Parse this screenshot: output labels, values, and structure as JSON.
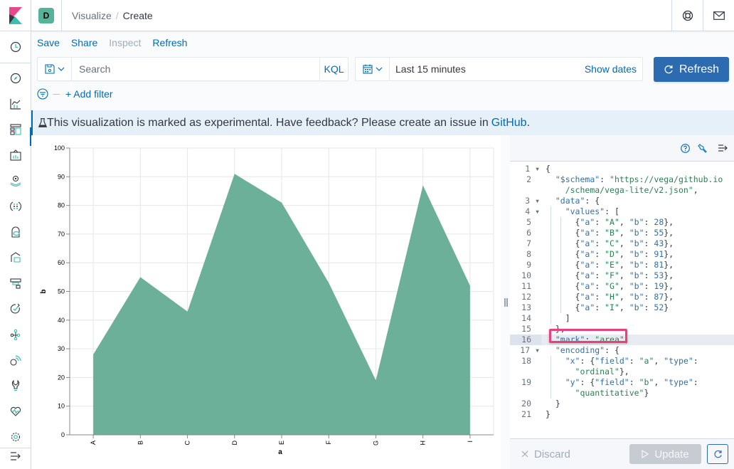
{
  "header": {
    "space_initial": "D",
    "breadcrumbs": [
      "Visualize",
      "Create"
    ],
    "separator": "/"
  },
  "topmenu": {
    "items": [
      {
        "label": "Save",
        "enabled": true
      },
      {
        "label": "Share",
        "enabled": true
      },
      {
        "label": "Inspect",
        "enabled": false
      },
      {
        "label": "Refresh",
        "enabled": true
      }
    ]
  },
  "querybar": {
    "search_placeholder": "Search",
    "search_value": "",
    "language": "KQL",
    "time_range": "Last 15 minutes",
    "show_dates": "Show dates",
    "refresh_label": "Refresh",
    "add_filter": "+ Add filter"
  },
  "banner": {
    "text": "This visualization is marked as experimental. Have feedback? Please create an issue in ",
    "link": "GitHub",
    "suffix": "."
  },
  "sidenav": {
    "items": [
      "recently-viewed",
      "discover",
      "visualize",
      "dashboard",
      "canvas",
      "maps",
      "machine-learning",
      "infrastructure",
      "logs",
      "apm",
      "uptime",
      "graph",
      "monitoring",
      "dev-tools",
      "stack-monitoring",
      "management",
      "collapse"
    ]
  },
  "colors": {
    "accent": "#006bb4",
    "area_fill": "#6db09a",
    "primary_button": "#2d6bb1",
    "highlight_box": "#e5427e"
  },
  "chart_data": {
    "type": "area",
    "categories": [
      "A",
      "B",
      "C",
      "D",
      "E",
      "F",
      "G",
      "H",
      "I"
    ],
    "values": [
      28,
      55,
      43,
      91,
      81,
      53,
      19,
      87,
      52
    ],
    "xlabel": "a",
    "ylabel": "b",
    "ylim": [
      0,
      100
    ],
    "yticks": [
      0,
      10,
      20,
      30,
      40,
      50,
      60,
      70,
      80,
      90,
      100
    ],
    "grid": true,
    "legend": "none"
  },
  "editor": {
    "lines": [
      {
        "n": "1",
        "fold": true,
        "html": "{"
      },
      {
        "n": "2",
        "fold": false,
        "html": "  <span class='k'>\"$schema\"</span>: <span class='s'>\"https://vega/github.io</span>"
      },
      {
        "n": "",
        "fold": false,
        "html": "    <span class='s'>/schema/vega-lite/v2.json\"</span>,"
      },
      {
        "n": "3",
        "fold": true,
        "html": "  <span class='k'>\"data\"</span>: {"
      },
      {
        "n": "4",
        "fold": true,
        "html": "    <span class='k'>\"values\"</span>: ["
      },
      {
        "n": "5",
        "fold": false,
        "html": "      {<span class='k'>\"a\"</span>: <span class='s'>\"A\"</span>, <span class='k'>\"b\"</span>: <span class='n'>28</span>},"
      },
      {
        "n": "6",
        "fold": false,
        "html": "      {<span class='k'>\"a\"</span>: <span class='s'>\"B\"</span>, <span class='k'>\"b\"</span>: <span class='n'>55</span>},"
      },
      {
        "n": "7",
        "fold": false,
        "html": "      {<span class='k'>\"a\"</span>: <span class='s'>\"C\"</span>, <span class='k'>\"b\"</span>: <span class='n'>43</span>},"
      },
      {
        "n": "8",
        "fold": false,
        "html": "      {<span class='k'>\"a\"</span>: <span class='s'>\"D\"</span>, <span class='k'>\"b\"</span>: <span class='n'>91</span>},"
      },
      {
        "n": "9",
        "fold": false,
        "html": "      {<span class='k'>\"a\"</span>: <span class='s'>\"E\"</span>, <span class='k'>\"b\"</span>: <span class='n'>81</span>},"
      },
      {
        "n": "10",
        "fold": false,
        "html": "      {<span class='k'>\"a\"</span>: <span class='s'>\"F\"</span>, <span class='k'>\"b\"</span>: <span class='n'>53</span>},"
      },
      {
        "n": "11",
        "fold": false,
        "html": "      {<span class='k'>\"a\"</span>: <span class='s'>\"G\"</span>, <span class='k'>\"b\"</span>: <span class='n'>19</span>},"
      },
      {
        "n": "12",
        "fold": false,
        "html": "      {<span class='k'>\"a\"</span>: <span class='s'>\"H\"</span>, <span class='k'>\"b\"</span>: <span class='n'>87</span>},"
      },
      {
        "n": "13",
        "fold": false,
        "html": "      {<span class='k'>\"a\"</span>: <span class='s'>\"I\"</span>, <span class='k'>\"b\"</span>: <span class='n'>52</span>}"
      },
      {
        "n": "14",
        "fold": false,
        "html": "    ]"
      },
      {
        "n": "15",
        "fold": false,
        "html": "  },"
      },
      {
        "n": "16",
        "fold": false,
        "active": true,
        "html": "  <span class='k'>\"mark\"</span>: <span class='s'>\"area\"</span>,"
      },
      {
        "n": "17",
        "fold": true,
        "html": "  <span class='k'>\"encoding\"</span>: {"
      },
      {
        "n": "18",
        "fold": false,
        "html": "    <span class='k'>\"x\"</span>: {<span class='k'>\"field\"</span>: <span class='s'>\"a\"</span>, <span class='k'>\"type\"</span>:"
      },
      {
        "n": "",
        "fold": false,
        "html": "      <span class='s'>\"ordinal\"</span>},"
      },
      {
        "n": "19",
        "fold": false,
        "html": "    <span class='k'>\"y\"</span>: {<span class='k'>\"field\"</span>: <span class='s'>\"b\"</span>, <span class='k'>\"type\"</span>:"
      },
      {
        "n": "",
        "fold": false,
        "html": "      <span class='s'>\"quantitative\"</span>}"
      },
      {
        "n": "20",
        "fold": false,
        "html": "  }"
      },
      {
        "n": "21",
        "fold": false,
        "html": "}"
      }
    ],
    "discard_label": "Discard",
    "update_label": "Update"
  }
}
